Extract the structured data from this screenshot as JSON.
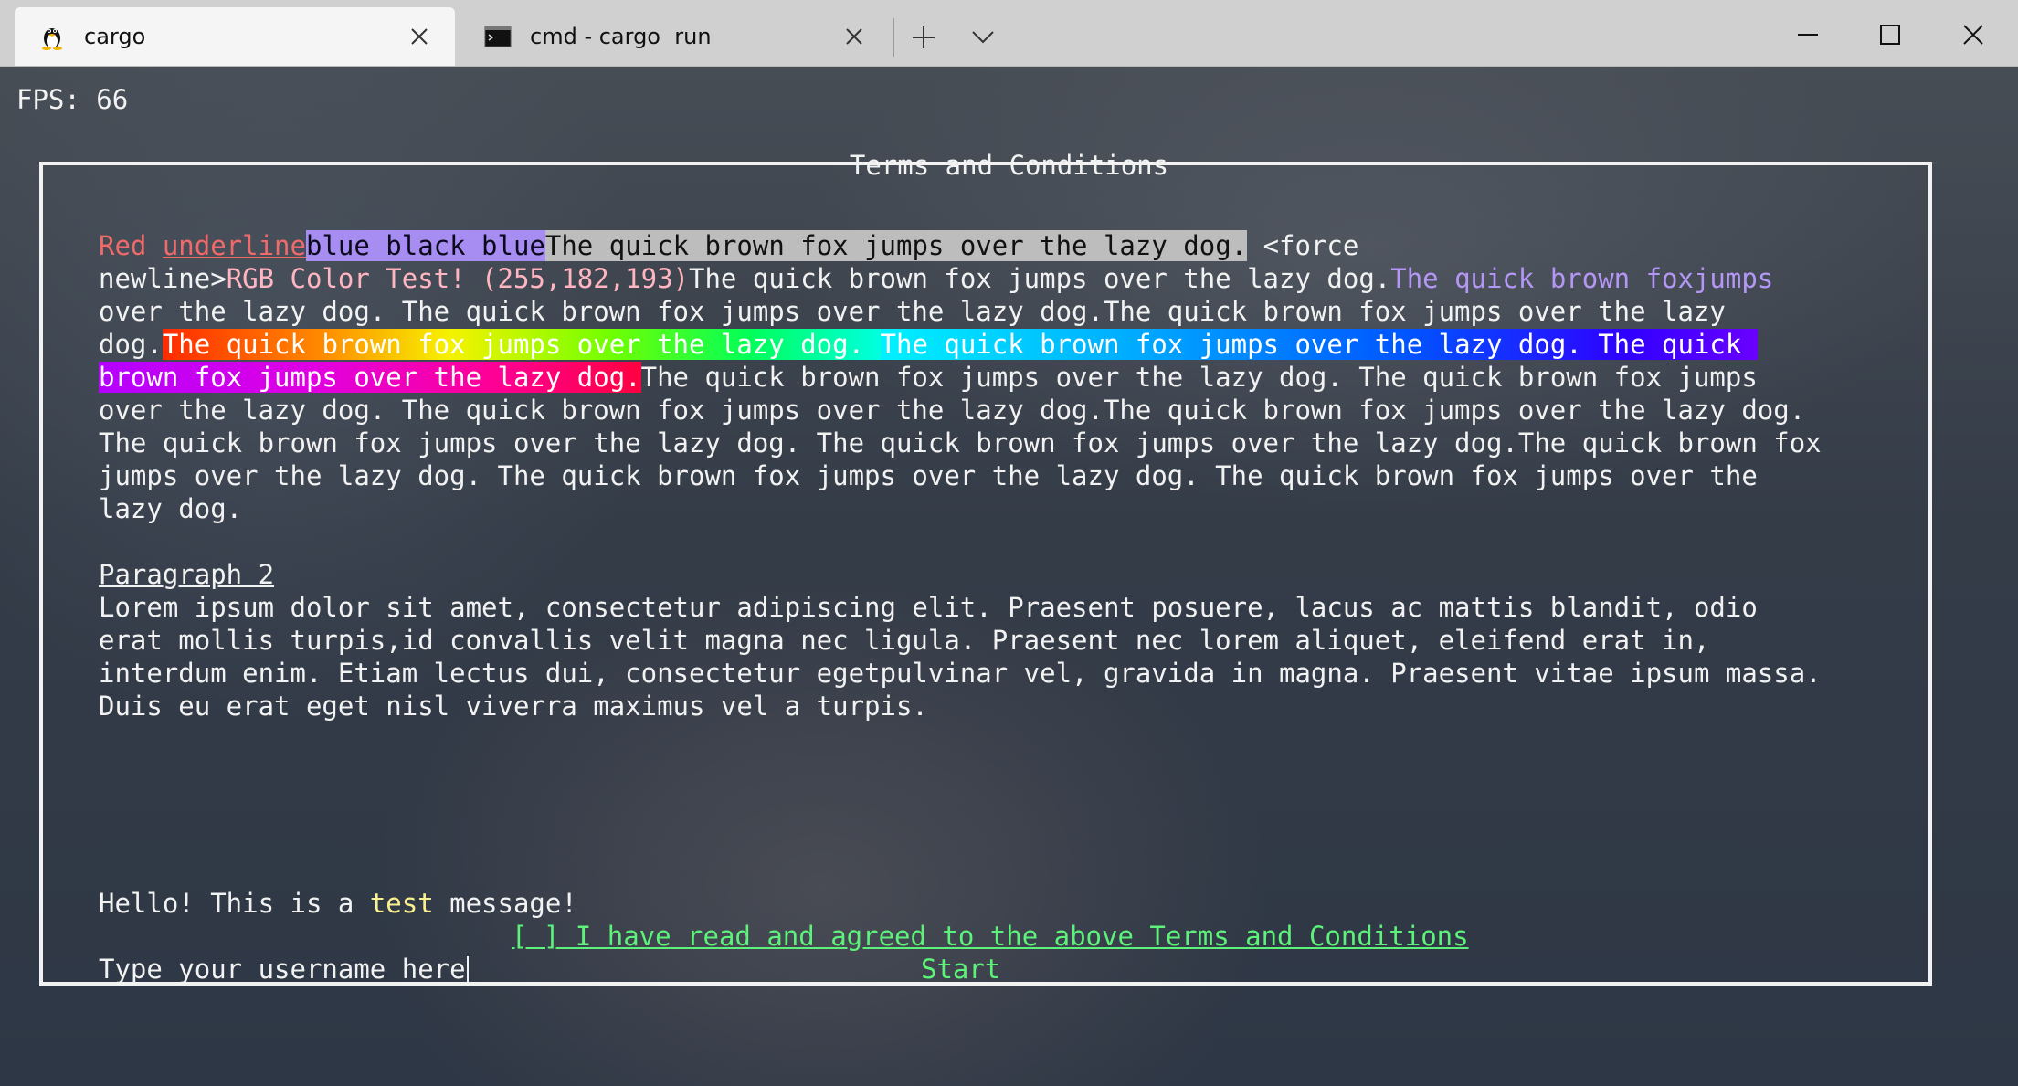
{
  "tabs": [
    {
      "label": "cargo",
      "icon": "linux-penguin-icon",
      "active": true
    },
    {
      "label": "cmd - cargo  run",
      "icon": "cmd-icon",
      "active": false
    }
  ],
  "fps": "FPS: 66",
  "panel": {
    "title": "Terms and Conditions",
    "lines": {
      "l0_red": "Red ",
      "l0_underline": "underline",
      "l0_blue": "blue black blue",
      "l0_grey": "The quick brown fox jumps over the lazy dog.",
      "l0_rest": " <force",
      "l1_a": "newline>",
      "l1_rgb": "RGB Color Test! (255,182,193)",
      "l1_b": "The quick brown fox jumps over the lazy dog.",
      "l1_purple": "The quick brown foxjumps",
      "l2": "over the lazy dog. The quick brown fox jumps over the lazy dog.The quick brown fox jumps over the lazy",
      "l3_a": "dog.",
      "l3_rb1": "The quick brown fox jumps over the lazy dog. ",
      "l3_rb2": "The quick brown fox jumps over the lazy dog. The quick ",
      "l4_rb3": "brown fox jumps over the lazy dog.",
      "l4_b": "The quick brown fox jumps over the lazy dog. The quick brown fox jumps",
      "l5": "over the lazy dog. The quick brown fox jumps over the lazy dog.The quick brown fox jumps over the lazy dog.",
      "l6": "The quick brown fox jumps over the lazy dog. The quick brown fox jumps over the lazy dog.The quick brown fox",
      "l7": "jumps over the lazy dog. The quick brown fox jumps over the lazy dog. The quick brown fox jumps over the",
      "l8": "lazy dog.",
      "p2_heading": "Paragraph 2",
      "p2_l1": "Lorem ipsum dolor sit amet, consectetur adipiscing elit. Praesent posuere, lacus ac mattis blandit, odio",
      "p2_l2": "erat mollis turpis,id convallis velit magna nec ligula. Praesent nec lorem aliquet, eleifend erat in,",
      "p2_l3": "interdum enim. Etiam lectus dui, consectetur egetpulvinar vel, gravida in magna. Praesent vitae ipsum massa.",
      "p2_l4": "Duis eu erat eget nisl viverra maximus vel a turpis."
    },
    "message_a": "Hello! This is a ",
    "message_b": "test",
    "message_c": " message!",
    "checkbox_label": "[ ] I have read and agreed to the above Terms and Conditions",
    "username_placeholder": "Type your username here",
    "start_label": "Start"
  }
}
